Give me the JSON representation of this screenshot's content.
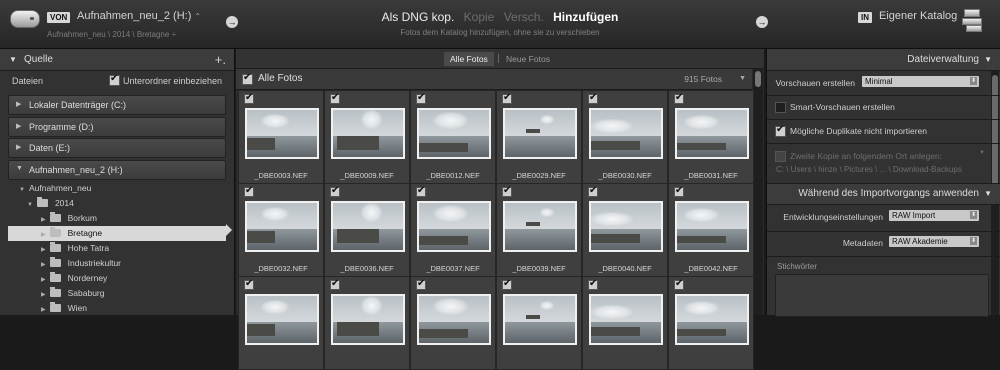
{
  "topbar": {
    "from_badge": "VON",
    "source_title": "Aufnahmen_neu_2 (H:)",
    "source_title_chevron": "⌃",
    "source_path": "Aufnahmen_neu \\ 2014 \\ Bretagne",
    "source_path_chevron": "÷",
    "arrow_left": "→",
    "modes": [
      "Als DNG kop.",
      "Kopie",
      "Versch.",
      "Hinzufügen"
    ],
    "mode_subtitle": "Fotos dem Katalog hinzufügen, ohne sie zu verschieben",
    "arrow_right": "→",
    "to_badge": "IN",
    "dest_title": "Eigener Katalog"
  },
  "left_panel": {
    "title": "Quelle",
    "plus": "+.",
    "files_label": "Dateien",
    "include_subfolders_label": "Unterordner einbeziehen",
    "include_subfolders_checked": true,
    "drives": [
      {
        "label": "Lokaler Datenträger (C:)",
        "expanded": false
      },
      {
        "label": "Programme (D:)",
        "expanded": false
      },
      {
        "label": "Daten (E:)",
        "expanded": false
      },
      {
        "label": "Aufnahmen_neu_2 (H:)",
        "expanded": true
      }
    ],
    "tree": [
      {
        "label": "Aufnahmen_neu",
        "level": 0
      },
      {
        "label": "2014",
        "level": 1
      },
      {
        "label": "Borkum",
        "level": 2
      },
      {
        "label": "Bretagne",
        "level": 2,
        "selected": true
      },
      {
        "label": "Hohe Tatra",
        "level": 2
      },
      {
        "label": "Industriekultur",
        "level": 2
      },
      {
        "label": "Norderney",
        "level": 2
      },
      {
        "label": "Sababurg",
        "level": 2
      },
      {
        "label": "Wien",
        "level": 2
      }
    ]
  },
  "center": {
    "tabs": [
      "Alle Fotos",
      "Neue Fotos"
    ],
    "active_tab": "Alle Fotos",
    "grid_title": "Alle Fotos",
    "grid_count": "915 Fotos",
    "photos": [
      "_DBE0003.NEF",
      "_DBE0009.NEF",
      "_DBE0012.NEF",
      "_DBE0029.NEF",
      "_DBE0030.NEF",
      "_DBE0031.NEF",
      "_DBE0032.NEF",
      "_DBE0036.NEF",
      "_DBE0037.NEF",
      "_DBE0039.NEF",
      "_DBE0040.NEF",
      "_DBE0042.NEF",
      "",
      "",
      "",
      "",
      "",
      ""
    ]
  },
  "right_panel": {
    "title": "Dateiverwaltung",
    "previews_label": "Vorschauen erstellen",
    "previews_value": "Minimal",
    "smart_previews_label": "Smart-Vorschauen erstellen",
    "smart_previews_checked": false,
    "no_duplicates_label": "Mögliche Duplikate nicht importieren",
    "no_duplicates_checked": true,
    "second_copy_label": "Zweite Kopie an folgendem Ort anlegen:",
    "second_copy_checked": false,
    "second_copy_path": "C: \\ Users \\ hinze \\ Pictures \\ ... \\ Download-Backups",
    "apply_title": "Während des Importvorgangs anwenden",
    "develop_label": "Entwicklungseinstellungen",
    "develop_value": "RAW Import",
    "metadata_label": "Metadaten",
    "metadata_value": "RAW Akademie",
    "keywords_label": "Stichwörter"
  },
  "icons": {
    "checkbox_check": "✔",
    "tri_down": "▼",
    "tri_right": "▶",
    "dropdown": "⬍",
    "caret": "▼"
  },
  "colors": {
    "panel_bg": "#323232",
    "grid_bg": "#2b2b2b",
    "cell_bg": "#3f3f3f",
    "selection": "#d8d8d8"
  }
}
